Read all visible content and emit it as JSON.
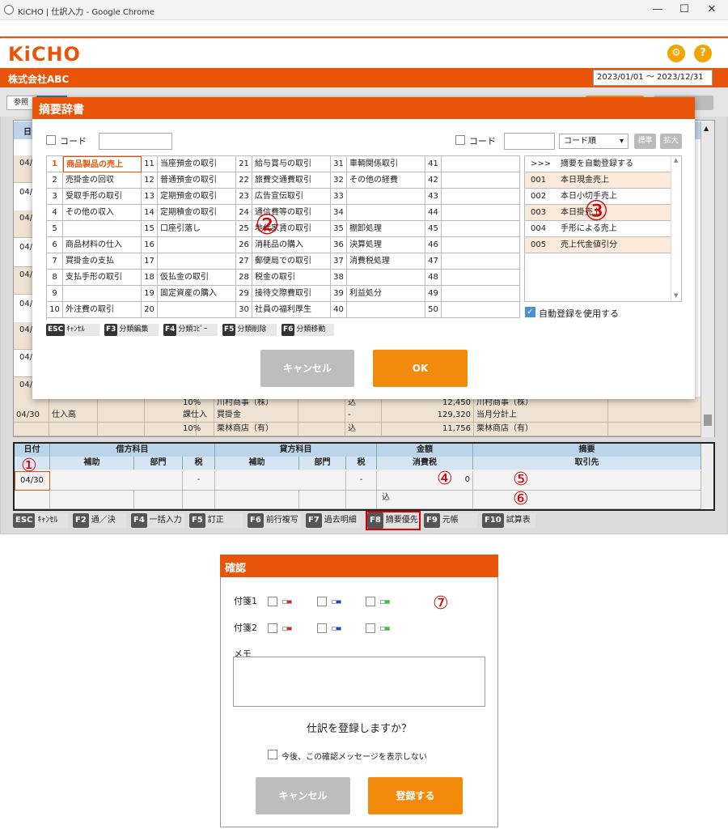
{
  "window": {
    "title": "KiCHO | 仕訳入力 - Google Chrome",
    "min": "—",
    "max": "☐",
    "close": "✕"
  },
  "app": {
    "logo": "KiCHO",
    "company": "株式会社ABC",
    "period": "2023/01/01 ～ 2023/12/31",
    "gear_icon": "gear-icon",
    "help_icon": "help-icon",
    "ref_label": "参照"
  },
  "journal": {
    "header_date": "日",
    "dates": [
      "04/",
      "04/",
      "04/",
      "04/",
      "04/",
      "04/",
      "04/",
      "04/",
      "04/"
    ],
    "rows": [
      {
        "date": "",
        "debit": "",
        "tax": "10%",
        "credit": "川村商事（株）",
        "flag": "込",
        "amount": "12,450",
        "memo": "川村商事（株）"
      },
      {
        "date": "04/30",
        "debit": "仕入高",
        "tax": "課仕入",
        "credit": "買掛金",
        "flag": "-",
        "amount": "129,320",
        "memo": "当月分計上"
      },
      {
        "date": "",
        "debit": "",
        "tax": "10%",
        "credit": "栗林商店（有）",
        "flag": "込",
        "amount": "11,756",
        "memo": "栗林商店（有）"
      }
    ]
  },
  "entry": {
    "h_date": "日付",
    "h_debit": "借方科目",
    "h_credit": "貸方科目",
    "h_amount": "金額",
    "h_memo": "摘要",
    "h_sub1": "補助",
    "h_dept1": "部門",
    "h_tax1": "税",
    "h_sub2": "補助",
    "h_dept2": "部門",
    "h_tax2": "税",
    "h_ctax": "消費税",
    "h_partner": "取引先",
    "date": "04/30",
    "dash1": "-",
    "dash2": "-",
    "zero": "0",
    "incl": "込"
  },
  "fkeys": [
    {
      "k": "ESC",
      "l": "ｷｬﾝｾﾙ"
    },
    {
      "k": "F2",
      "l": "通／決"
    },
    {
      "k": "F4",
      "l": "一括入力"
    },
    {
      "k": "F5",
      "l": "訂正"
    },
    {
      "k": "F6",
      "l": "前行複写"
    },
    {
      "k": "F7",
      "l": "過去明細"
    },
    {
      "k": "F8",
      "l": "摘要優先"
    },
    {
      "k": "F9",
      "l": "元帳"
    },
    {
      "k": "F10",
      "l": "試算表"
    }
  ],
  "circles": [
    "①",
    "②",
    "③",
    "④",
    "⑤",
    "⑥",
    "⑦"
  ],
  "dict": {
    "title": "摘要辞書",
    "code_label": "コード",
    "code_label2": "コード",
    "sort": "コード順",
    "std": "標準",
    "expand": "拡大",
    "grid": [
      [
        {
          "n": "1",
          "l": "商品製品の売上"
        },
        {
          "n": "11",
          "l": "当座預金の取引"
        },
        {
          "n": "21",
          "l": "給与賞与の取引"
        },
        {
          "n": "31",
          "l": "車輌関係取引"
        },
        {
          "n": "41",
          "l": ""
        }
      ],
      [
        {
          "n": "2",
          "l": "売掛金の回収"
        },
        {
          "n": "12",
          "l": "普通預金の取引"
        },
        {
          "n": "22",
          "l": "旅費交通費取引"
        },
        {
          "n": "32",
          "l": "その他の経費"
        },
        {
          "n": "42",
          "l": ""
        }
      ],
      [
        {
          "n": "3",
          "l": "受取手形の取引"
        },
        {
          "n": "13",
          "l": "定期預金の取引"
        },
        {
          "n": "23",
          "l": "広告宣伝取引"
        },
        {
          "n": "33",
          "l": ""
        },
        {
          "n": "43",
          "l": ""
        }
      ],
      [
        {
          "n": "4",
          "l": "その他の収入"
        },
        {
          "n": "14",
          "l": "定期積金の取引"
        },
        {
          "n": "24",
          "l": "通信費等の取引"
        },
        {
          "n": "34",
          "l": ""
        },
        {
          "n": "44",
          "l": ""
        }
      ],
      [
        {
          "n": "5",
          "l": ""
        },
        {
          "n": "15",
          "l": "口座引落し"
        },
        {
          "n": "25",
          "l": "地代家賃の取引"
        },
        {
          "n": "35",
          "l": "棚卸処理"
        },
        {
          "n": "45",
          "l": ""
        }
      ],
      [
        {
          "n": "6",
          "l": "商品材料の仕入"
        },
        {
          "n": "16",
          "l": ""
        },
        {
          "n": "26",
          "l": "消耗品の購入"
        },
        {
          "n": "36",
          "l": "決算処理"
        },
        {
          "n": "46",
          "l": ""
        }
      ],
      [
        {
          "n": "7",
          "l": "買掛金の支払"
        },
        {
          "n": "17",
          "l": ""
        },
        {
          "n": "27",
          "l": "郵便局での取引"
        },
        {
          "n": "37",
          "l": "消費税処理"
        },
        {
          "n": "47",
          "l": ""
        }
      ],
      [
        {
          "n": "8",
          "l": "支払手形の取引"
        },
        {
          "n": "18",
          "l": "仮払金の取引"
        },
        {
          "n": "28",
          "l": "税金の取引"
        },
        {
          "n": "38",
          "l": ""
        },
        {
          "n": "48",
          "l": ""
        }
      ],
      [
        {
          "n": "9",
          "l": ""
        },
        {
          "n": "19",
          "l": "固定資産の購入"
        },
        {
          "n": "29",
          "l": "接待交際費取引"
        },
        {
          "n": "39",
          "l": "利益処分"
        },
        {
          "n": "49",
          "l": ""
        }
      ],
      [
        {
          "n": "10",
          "l": "外注費の取引"
        },
        {
          "n": "20",
          "l": ""
        },
        {
          "n": "30",
          "l": "社員の福利厚生"
        },
        {
          "n": "40",
          "l": ""
        },
        {
          "n": "50",
          "l": ""
        }
      ]
    ],
    "list": [
      {
        "c": ">>>",
        "l": "摘要を自動登録する"
      },
      {
        "c": "001",
        "l": "本日現金売上"
      },
      {
        "c": "002",
        "l": "本日小切手売上"
      },
      {
        "c": "003",
        "l": "本日掛売上"
      },
      {
        "c": "004",
        "l": "手形による売上"
      },
      {
        "c": "005",
        "l": "売上代金値引分"
      }
    ],
    "auto_label": "自動登録を使用する",
    "keys": [
      {
        "k": "ESC",
        "l": "ｷｬﾝｾﾙ"
      },
      {
        "k": "F3",
        "l": "分類編集"
      },
      {
        "k": "F4",
        "l": "分類ｺﾋﾟｰ"
      },
      {
        "k": "F5",
        "l": "分類削除"
      },
      {
        "k": "F6",
        "l": "分類移動"
      }
    ],
    "cancel": "キャンセル",
    "ok": "OK"
  },
  "confirm": {
    "title": "確認",
    "tag1": "付箋1",
    "tag2": "付箋2",
    "memo": "メモ",
    "question": "仕訳を登録しますか？",
    "dont_show": "今後、この確認メッセージを表示しない",
    "cancel": "キャンセル",
    "register": "登録する",
    "tag_colors": [
      "#e0202a",
      "#1f3fd0",
      "#22cc33"
    ]
  }
}
